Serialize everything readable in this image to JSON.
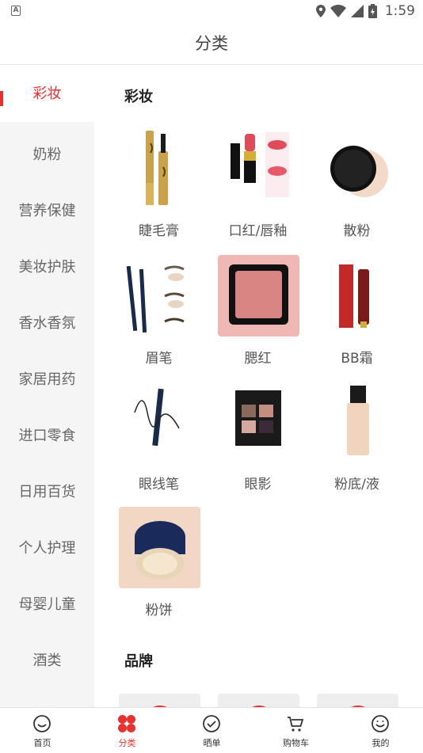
{
  "status_bar": {
    "time": "1:59",
    "notification_icon": "a-notification-icon"
  },
  "header": {
    "title": "分类"
  },
  "sidebar": {
    "items": [
      {
        "label": "彩妆",
        "active": true
      },
      {
        "label": "奶粉"
      },
      {
        "label": "营养保健"
      },
      {
        "label": "美妆护肤"
      },
      {
        "label": "香水香氛"
      },
      {
        "label": "家居用药"
      },
      {
        "label": "进口零食"
      },
      {
        "label": "日用百货"
      },
      {
        "label": "个人护理"
      },
      {
        "label": "母婴儿童"
      },
      {
        "label": "酒类"
      }
    ]
  },
  "main": {
    "section_makeup": "彩妆",
    "products": [
      {
        "label": "睫毛膏",
        "icon": "mascara-image"
      },
      {
        "label": "口红/唇釉",
        "icon": "lipstick-image"
      },
      {
        "label": "散粉",
        "icon": "loose-powder-image"
      },
      {
        "label": "眉笔",
        "icon": "eyebrow-pencil-image"
      },
      {
        "label": "腮红",
        "icon": "blush-image"
      },
      {
        "label": "BB霜",
        "icon": "bb-cream-image"
      },
      {
        "label": "眼线笔",
        "icon": "eyeliner-image"
      },
      {
        "label": "眼影",
        "icon": "eyeshadow-image"
      },
      {
        "label": "粉底/液",
        "icon": "foundation-image"
      },
      {
        "label": "粉饼",
        "icon": "pressed-powder-image"
      }
    ],
    "section_brand": "品牌"
  },
  "tabbar": {
    "tabs": [
      {
        "label": "首页",
        "icon": "home-icon"
      },
      {
        "label": "分类",
        "icon": "category-icon",
        "active": true
      },
      {
        "label": "晒单",
        "icon": "check-circle-icon"
      },
      {
        "label": "购物车",
        "icon": "cart-icon"
      },
      {
        "label": "我的",
        "icon": "profile-icon"
      }
    ]
  },
  "colors": {
    "accent": "#e8302e",
    "sidebar_bg": "#f5f5f5"
  }
}
